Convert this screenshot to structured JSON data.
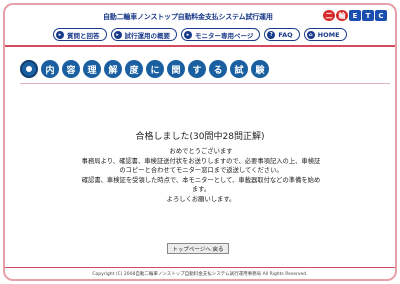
{
  "header": {
    "title": "自動二輪車ノンストップ自動料金支払システム試行運用",
    "logo_letters": [
      "二",
      "輪",
      "E",
      "T",
      "C"
    ]
  },
  "nav": {
    "items": [
      {
        "label": "質問と回答",
        "icon": "chevron-right-icon"
      },
      {
        "label": "試行運用の概要",
        "icon": "chevron-right-icon"
      },
      {
        "label": "モニター専用ページ",
        "icon": "chevron-right-icon"
      },
      {
        "label": "FAQ",
        "icon": "question-icon"
      },
      {
        "label": "HOME",
        "icon": "home-icon"
      }
    ]
  },
  "page": {
    "heading_chars": [
      "内",
      "容",
      "理",
      "解",
      "度",
      "に",
      "関",
      "す",
      "る",
      "試",
      "験"
    ]
  },
  "result": {
    "title": "合格しました(30問中28問正解)",
    "lines": [
      "おめでとうございます",
      "事務局より、確認書、車検証送付状をお送りしますので、必要事項記入の上、車検証",
      "のコピーと合わせてモニター窓口まで返送してください。",
      "確認書、車検証を受領した時点で、本モニターとして、車載器取付などの準備を始め",
      "ます。",
      "よろしくお願いします。"
    ]
  },
  "button": {
    "label": "トップページへ 戻る"
  },
  "footer": {
    "copyright": "Copyright (C) 2008自動二輪車ノンストップ自動料金支払システム試行運用事務局 All Rights Reserved."
  },
  "colors": {
    "accent_blue": "#1a3a8a",
    "accent_pink": "#d64860",
    "logo_red": "#d62a2a"
  }
}
